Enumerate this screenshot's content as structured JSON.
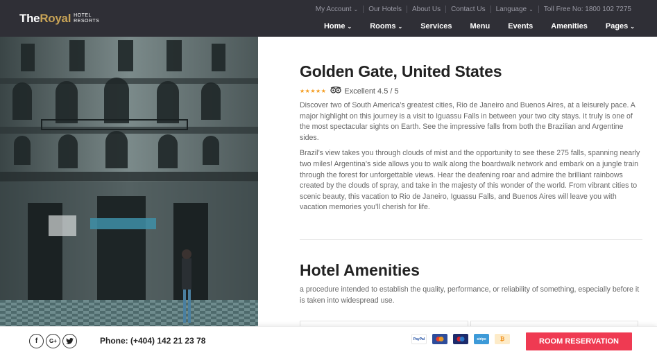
{
  "brand": {
    "name_part1": "The",
    "name_part2": "Royal",
    "sub_line1": "HOTEL",
    "sub_line2": "RESORTS",
    "accent": "#c8a356"
  },
  "topbar": {
    "items": [
      "My Account",
      "Our Hotels",
      "About Us",
      "Contact Us",
      "Language",
      "Toll Free No: 1800 102 7275"
    ]
  },
  "nav": {
    "items": [
      {
        "label": "Home",
        "dropdown": true
      },
      {
        "label": "Rooms",
        "dropdown": true
      },
      {
        "label": "Services",
        "dropdown": false
      },
      {
        "label": "Menu",
        "dropdown": false
      },
      {
        "label": "Events",
        "dropdown": false
      },
      {
        "label": "Amenities",
        "dropdown": false
      },
      {
        "label": "Pages",
        "dropdown": true
      }
    ]
  },
  "hotel": {
    "title": "Golden Gate, United States",
    "stars": "★★★★★",
    "rating_text": "Excellent 4.5 / 5",
    "paragraph1": "Discover two of South America’s greatest cities, Rio de Janeiro and Buenos Aires, at a leisurely pace. A major highlight on this journey is a visit to Iguassu Falls in between your two city stays. It truly is one of the most spectacular sights on Earth. See the impressive falls from both the Brazilian and Argentine sides.",
    "paragraph2": "Brazil’s view takes you through clouds of mist and the opportunity to see these 275 falls, spanning nearly two miles! Argentina’s side allows you to walk along the boardwalk network and embark on a jungle train through the forest for unforgettable views. Hear the deafening roar and admire the brilliant rainbows created by the clouds of spray, and take in the majesty of this wonder of the world. From vibrant cities to scenic beauty, this vacation to Rio de Janeiro, Iguassu Falls, and Buenos Aires will leave you with vacation memories you’ll cherish for life."
  },
  "amenities": {
    "title": "Hotel Amenities",
    "description": "a procedure intended to establish the quality, performance, or reliability of something, especially before it is taken into widespread use."
  },
  "bottombar": {
    "social_icons": [
      "facebook-icon",
      "google-plus-icon",
      "twitter-icon"
    ],
    "phone": "Phone: (+404) 142 21 23 78",
    "payments": [
      {
        "name": "paypal",
        "label": "PayPal"
      },
      {
        "name": "mastercard",
        "label": ""
      },
      {
        "name": "maestro",
        "label": ""
      },
      {
        "name": "stripe",
        "label": "stripe"
      },
      {
        "name": "bitcoin",
        "label": "₿"
      }
    ],
    "reserve_label": "ROOM RESERVATION",
    "reserve_color": "#ef3a52"
  }
}
